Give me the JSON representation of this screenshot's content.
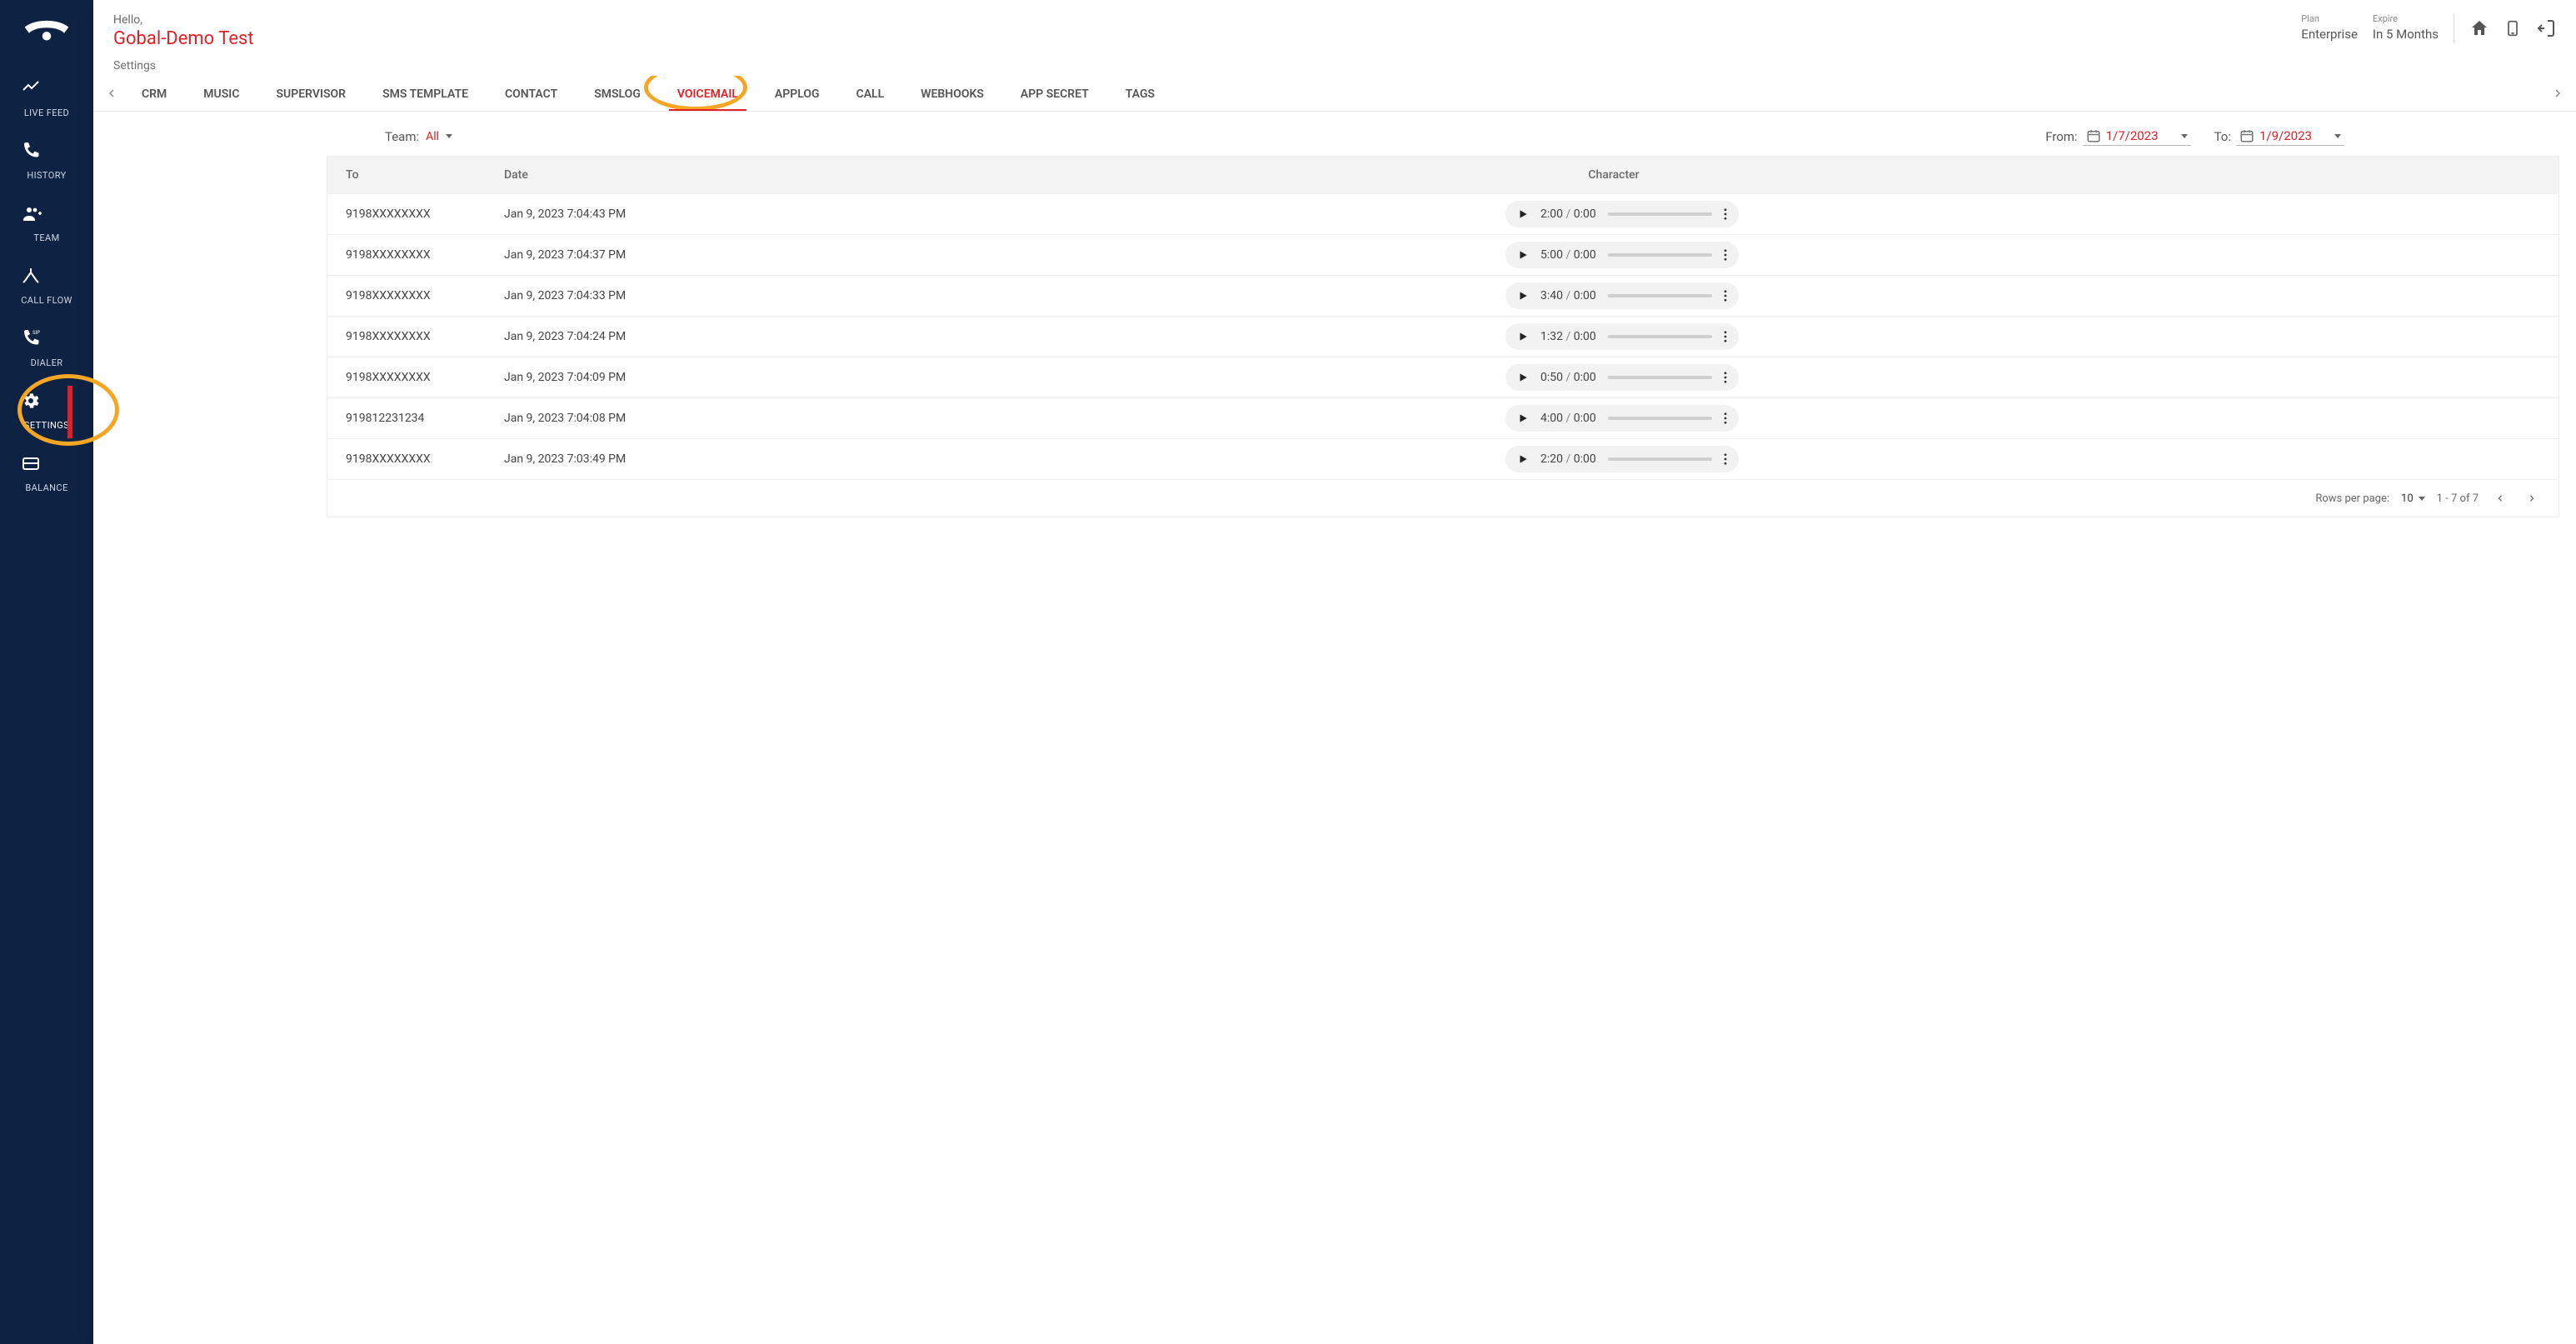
{
  "header": {
    "hello": "Hello,",
    "user_name": "Gobal-Demo Test",
    "plan_label": "Plan",
    "plan_value": "Enterprise",
    "expire_label": "Expire",
    "expire_value": "In 5 Months"
  },
  "breadcrumb": "Settings",
  "sidebar": {
    "items": [
      {
        "label": "LIVE FEED"
      },
      {
        "label": "HISTORY"
      },
      {
        "label": "TEAM"
      },
      {
        "label": "CALL FLOW"
      },
      {
        "label": "DIALER"
      },
      {
        "label": "SETTINGS"
      },
      {
        "label": "BALANCE"
      }
    ],
    "active_index": 5
  },
  "tabs": {
    "items": [
      "CRM",
      "MUSIC",
      "SUPERVISOR",
      "SMS TEMPLATE",
      "CONTACT",
      "SMSLOG",
      "VOICEMAIL",
      "APPLOG",
      "CALL",
      "WEBHOOKS",
      "APP SECRET",
      "TAGS"
    ],
    "active_index": 6
  },
  "filters": {
    "team_label": "Team:",
    "team_value": "All",
    "from_label": "From:",
    "from_value": "1/7/2023",
    "to_label": "To:",
    "to_value": "1/9/2023"
  },
  "table": {
    "columns": {
      "to": "To",
      "date": "Date",
      "character": "Character"
    },
    "rows": [
      {
        "to": "9198XXXXXXXX",
        "date": "Jan 9, 2023 7:04:43 PM",
        "elapsed": "2:00",
        "total": "0:00"
      },
      {
        "to": "9198XXXXXXXX",
        "date": "Jan 9, 2023 7:04:37 PM",
        "elapsed": "5:00",
        "total": "0:00"
      },
      {
        "to": "9198XXXXXXXX",
        "date": "Jan 9, 2023 7:04:33 PM",
        "elapsed": "3:40",
        "total": "0:00"
      },
      {
        "to": "9198XXXXXXXX",
        "date": "Jan 9, 2023 7:04:24 PM",
        "elapsed": "1:32",
        "total": "0:00"
      },
      {
        "to": "9198XXXXXXXX",
        "date": "Jan 9, 2023 7:04:09 PM",
        "elapsed": "0:50",
        "total": "0:00"
      },
      {
        "to": "919812231234",
        "date": "Jan 9, 2023 7:04:08 PM",
        "elapsed": "4:00",
        "total": "0:00"
      },
      {
        "to": "9198XXXXXXXX",
        "date": "Jan 9, 2023 7:03:49 PM",
        "elapsed": "2:20",
        "total": "0:00"
      }
    ]
  },
  "pagination": {
    "rows_per_page_label": "Rows per page:",
    "rows_per_page_value": "10",
    "range_text": "1 - 7 of 7"
  },
  "colors": {
    "brand_red": "#e01f26",
    "accent_orange": "#f5a623",
    "nav_bg": "#0e2244"
  }
}
